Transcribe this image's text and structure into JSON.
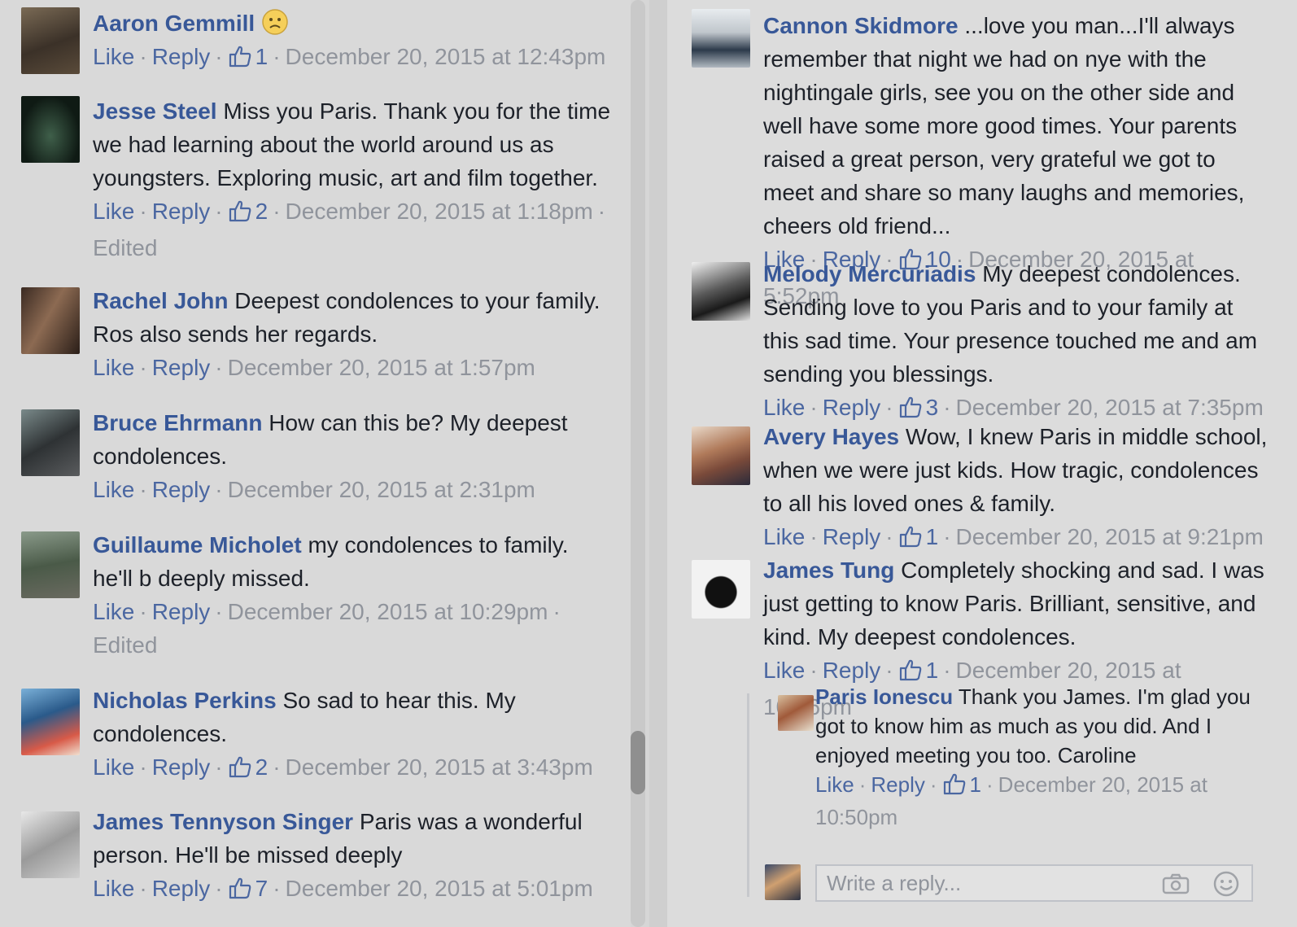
{
  "actions": {
    "like": "Like",
    "reply": "Reply",
    "edited": "Edited",
    "sep": "·"
  },
  "left_comments": [
    {
      "name": "Aaron Gemmill",
      "text": "",
      "likes": "1",
      "date": "December 20, 2015 at 12:43pm",
      "emoji": "frown",
      "edited": false
    },
    {
      "name": "Jesse Steel",
      "text": "Miss you Paris. Thank you for the time we had learning about the world around us as youngsters. Exploring music, art and film together.",
      "likes": "2",
      "date": "December 20, 2015 at 1:18pm",
      "edited": true
    },
    {
      "name": "Rachel John",
      "text": "Deepest condolences to your family. Ros also sends her regards.",
      "likes": "",
      "date": "December 20, 2015 at 1:57pm",
      "edited": false
    },
    {
      "name": "Bruce Ehrmann",
      "text": "How can this be? My deepest condolences.",
      "likes": "",
      "date": "December 20, 2015 at 2:31pm",
      "edited": false
    },
    {
      "name": "Guillaume Micholet",
      "text": "my condolences to family. he'll b deeply missed.",
      "likes": "",
      "date": "December 20, 2015 at 10:29pm",
      "edited": true
    },
    {
      "name": "Nicholas Perkins",
      "text": "So sad to hear this. My condolences.",
      "likes": "2",
      "date": "December 20, 2015 at 3:43pm",
      "edited": false
    },
    {
      "name": "James Tennyson Singer",
      "text": "Paris was a wonderful person. He'll be missed deeply",
      "likes": "7",
      "date": "December 20, 2015 at 5:01pm",
      "edited": false
    }
  ],
  "right_comments": [
    {
      "name": "Cannon Skidmore",
      "text": "...love you man...I'll always remember that night we had on nye with the nightingale girls, see you on the other side and well have some more good times. Your parents raised a great person, very grateful we got to meet and share so many laughs and memories, cheers old friend...",
      "likes": "10",
      "date": "December 20, 2015 at 5:52pm"
    },
    {
      "name": "Melody Mercuriadis",
      "text": "My deepest condolences. Sending love to you Paris and to your family at this sad time. Your presence touched me and am sending you blessings.",
      "likes": "3",
      "date": "December 20, 2015 at 7:35pm"
    },
    {
      "name": "Avery Hayes",
      "text": "Wow, I knew Paris in middle school, when we were just kids. How tragic, condolences to all his loved ones & family.",
      "likes": "1",
      "date": "December 20, 2015 at 9:21pm"
    },
    {
      "name": "James Tung",
      "text": "Completely shocking and sad. I was just getting to know Paris. Brilliant, sensitive, and kind. My deepest condolences.",
      "likes": "1",
      "date": "December 20, 2015 at 10:36pm"
    }
  ],
  "reply": {
    "name": "Paris Ionescu",
    "text": "Thank you James. I'm glad you got to know him as much as you did. And I enjoyed meeting you too. Caroline",
    "likes": "1",
    "date": "December 20, 2015 at 10:50pm"
  },
  "reply_input": {
    "placeholder": "Write a reply..."
  },
  "icons": {
    "camera": "camera-icon",
    "smile": "smiley-icon",
    "thumb": "thumbs-up-icon"
  }
}
